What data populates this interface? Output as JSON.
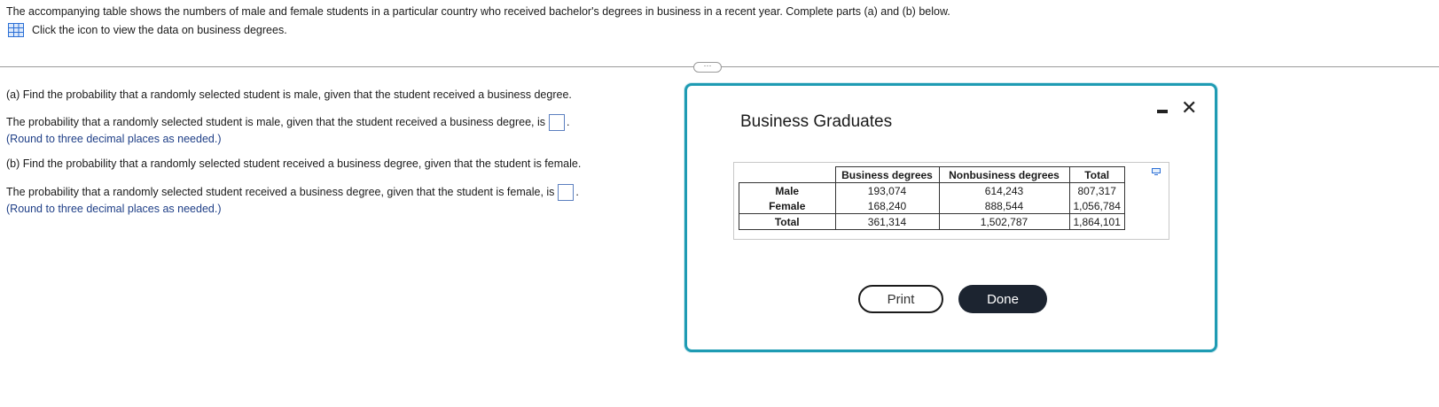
{
  "intro": "The accompanying table shows the numbers of male and female students in a particular country who received bachelor's degrees in business in a recent year. Complete parts (a) and (b) below.",
  "icon_link": "Click the icon to view the data on business degrees.",
  "ellipsis": "···",
  "part_a": {
    "question": "(a) Find the probability that a randomly selected student is male, given that the student received a business degree.",
    "answer_prefix": "The probability that a randomly selected student is male, given that the student received a business degree, is",
    "hint": "(Round to three decimal places as needed.)"
  },
  "part_b": {
    "question": "(b) Find the probability that a randomly selected student received a business degree, given that the student is female.",
    "answer_prefix": "The probability that a randomly selected student received a business degree, given that the student is female, is",
    "hint": "(Round to three decimal places as needed.)"
  },
  "modal": {
    "title": "Business Graduates",
    "print_label": "Print",
    "done_label": "Done",
    "table": {
      "headers": [
        "Business degrees",
        "Nonbusiness degrees",
        "Total"
      ],
      "rows": [
        {
          "label": "Male",
          "values": [
            "193,074",
            "614,243",
            "807,317"
          ]
        },
        {
          "label": "Female",
          "values": [
            "168,240",
            "888,544",
            "1,056,784"
          ]
        },
        {
          "label": "Total",
          "values": [
            "361,314",
            "1,502,787",
            "1,864,101"
          ]
        }
      ]
    }
  },
  "colors": {
    "modal_border": "#1e9bb3",
    "hint_text": "#1f3f87",
    "icon_blue": "#2b6fd6",
    "done_button": "#1c2430"
  }
}
